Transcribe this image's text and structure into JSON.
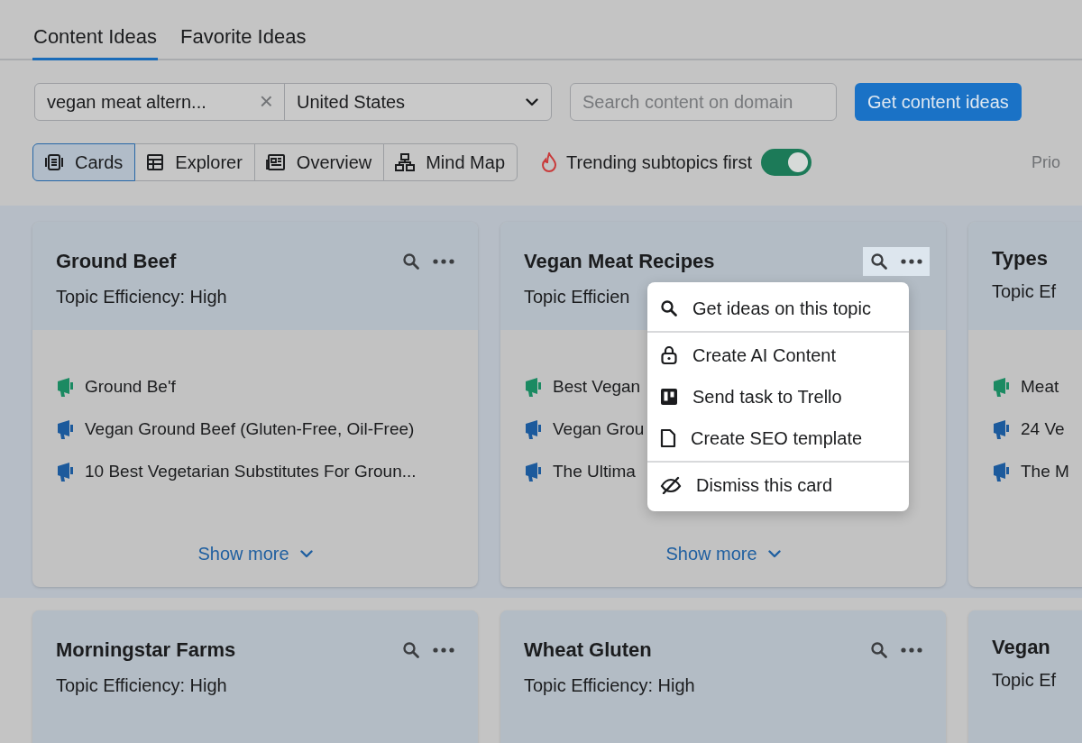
{
  "tabs": [
    {
      "label": "Content Ideas",
      "selected": true
    },
    {
      "label": "Favorite Ideas",
      "selected": false
    }
  ],
  "search": {
    "query": "vegan meat altern...",
    "clear": "×",
    "country": "United States",
    "domain_placeholder": "Search content on domain",
    "submit": "Get content ideas"
  },
  "views": [
    {
      "kind": "cards",
      "label": "Cards",
      "selected": true
    },
    {
      "kind": "explorer",
      "label": "Explorer",
      "selected": false
    },
    {
      "kind": "overview",
      "label": "Overview",
      "selected": false
    },
    {
      "kind": "mindmap",
      "label": "Mind Map",
      "selected": false
    }
  ],
  "trending_toggle": {
    "label": "Trending subtopics first",
    "on": true
  },
  "sort_label": "Prio",
  "card_rows": [
    {
      "highlighted": true,
      "cards": [
        {
          "title": "Ground Beef",
          "subtitle": "Topic Efficiency: High",
          "menu_open": false,
          "show_more": "Show more",
          "items": [
            {
              "text": "Ground Be'f",
              "color": "#1b8a62"
            },
            {
              "text": "Vegan Ground Beef (Gluten-Free, Oil-Free)",
              "color": "#1c5a9c"
            },
            {
              "text": "10 Best Vegetarian Substitutes For Groun...",
              "color": "#1c5a9c"
            }
          ]
        },
        {
          "title": "Vegan Meat Recipes",
          "subtitle": "Topic Efficien",
          "menu_open": true,
          "show_more": "Show more",
          "items": [
            {
              "text": "Best Vegan",
              "color": "#1b8a62"
            },
            {
              "text": "Vegan Grou",
              "color": "#1c5a9c"
            },
            {
              "text": "The Ultima",
              "color": "#1c5a9c"
            }
          ]
        },
        {
          "title": "Types",
          "subtitle": "Topic Ef",
          "items": [
            {
              "text": "Meat",
              "color": "#1b8a62"
            },
            {
              "text": "24 Ve",
              "color": "#1c5a9c"
            },
            {
              "text": "The M",
              "color": "#1c5a9c"
            }
          ]
        }
      ]
    },
    {
      "highlighted": false,
      "cards": [
        {
          "title": "Morningstar Farms",
          "subtitle": "Topic Efficiency: High",
          "menu_open": false
        },
        {
          "title": "Wheat Gluten",
          "subtitle": "Topic Efficiency: High",
          "menu_open": false
        },
        {
          "title": "Vegan",
          "subtitle": "Topic Ef"
        }
      ]
    }
  ],
  "card_menu": {
    "items": [
      {
        "kind": "search",
        "label": "Get ideas on this topic",
        "divider_after": true
      },
      {
        "kind": "lock",
        "label": "Create AI Content",
        "divider_after": false
      },
      {
        "kind": "board",
        "label": "Send task to Trello",
        "divider_after": false
      },
      {
        "kind": "document",
        "label": "Create SEO template",
        "divider_after": true
      },
      {
        "kind": "hidden",
        "label": "Dismiss this card",
        "divider_after": false
      }
    ]
  }
}
